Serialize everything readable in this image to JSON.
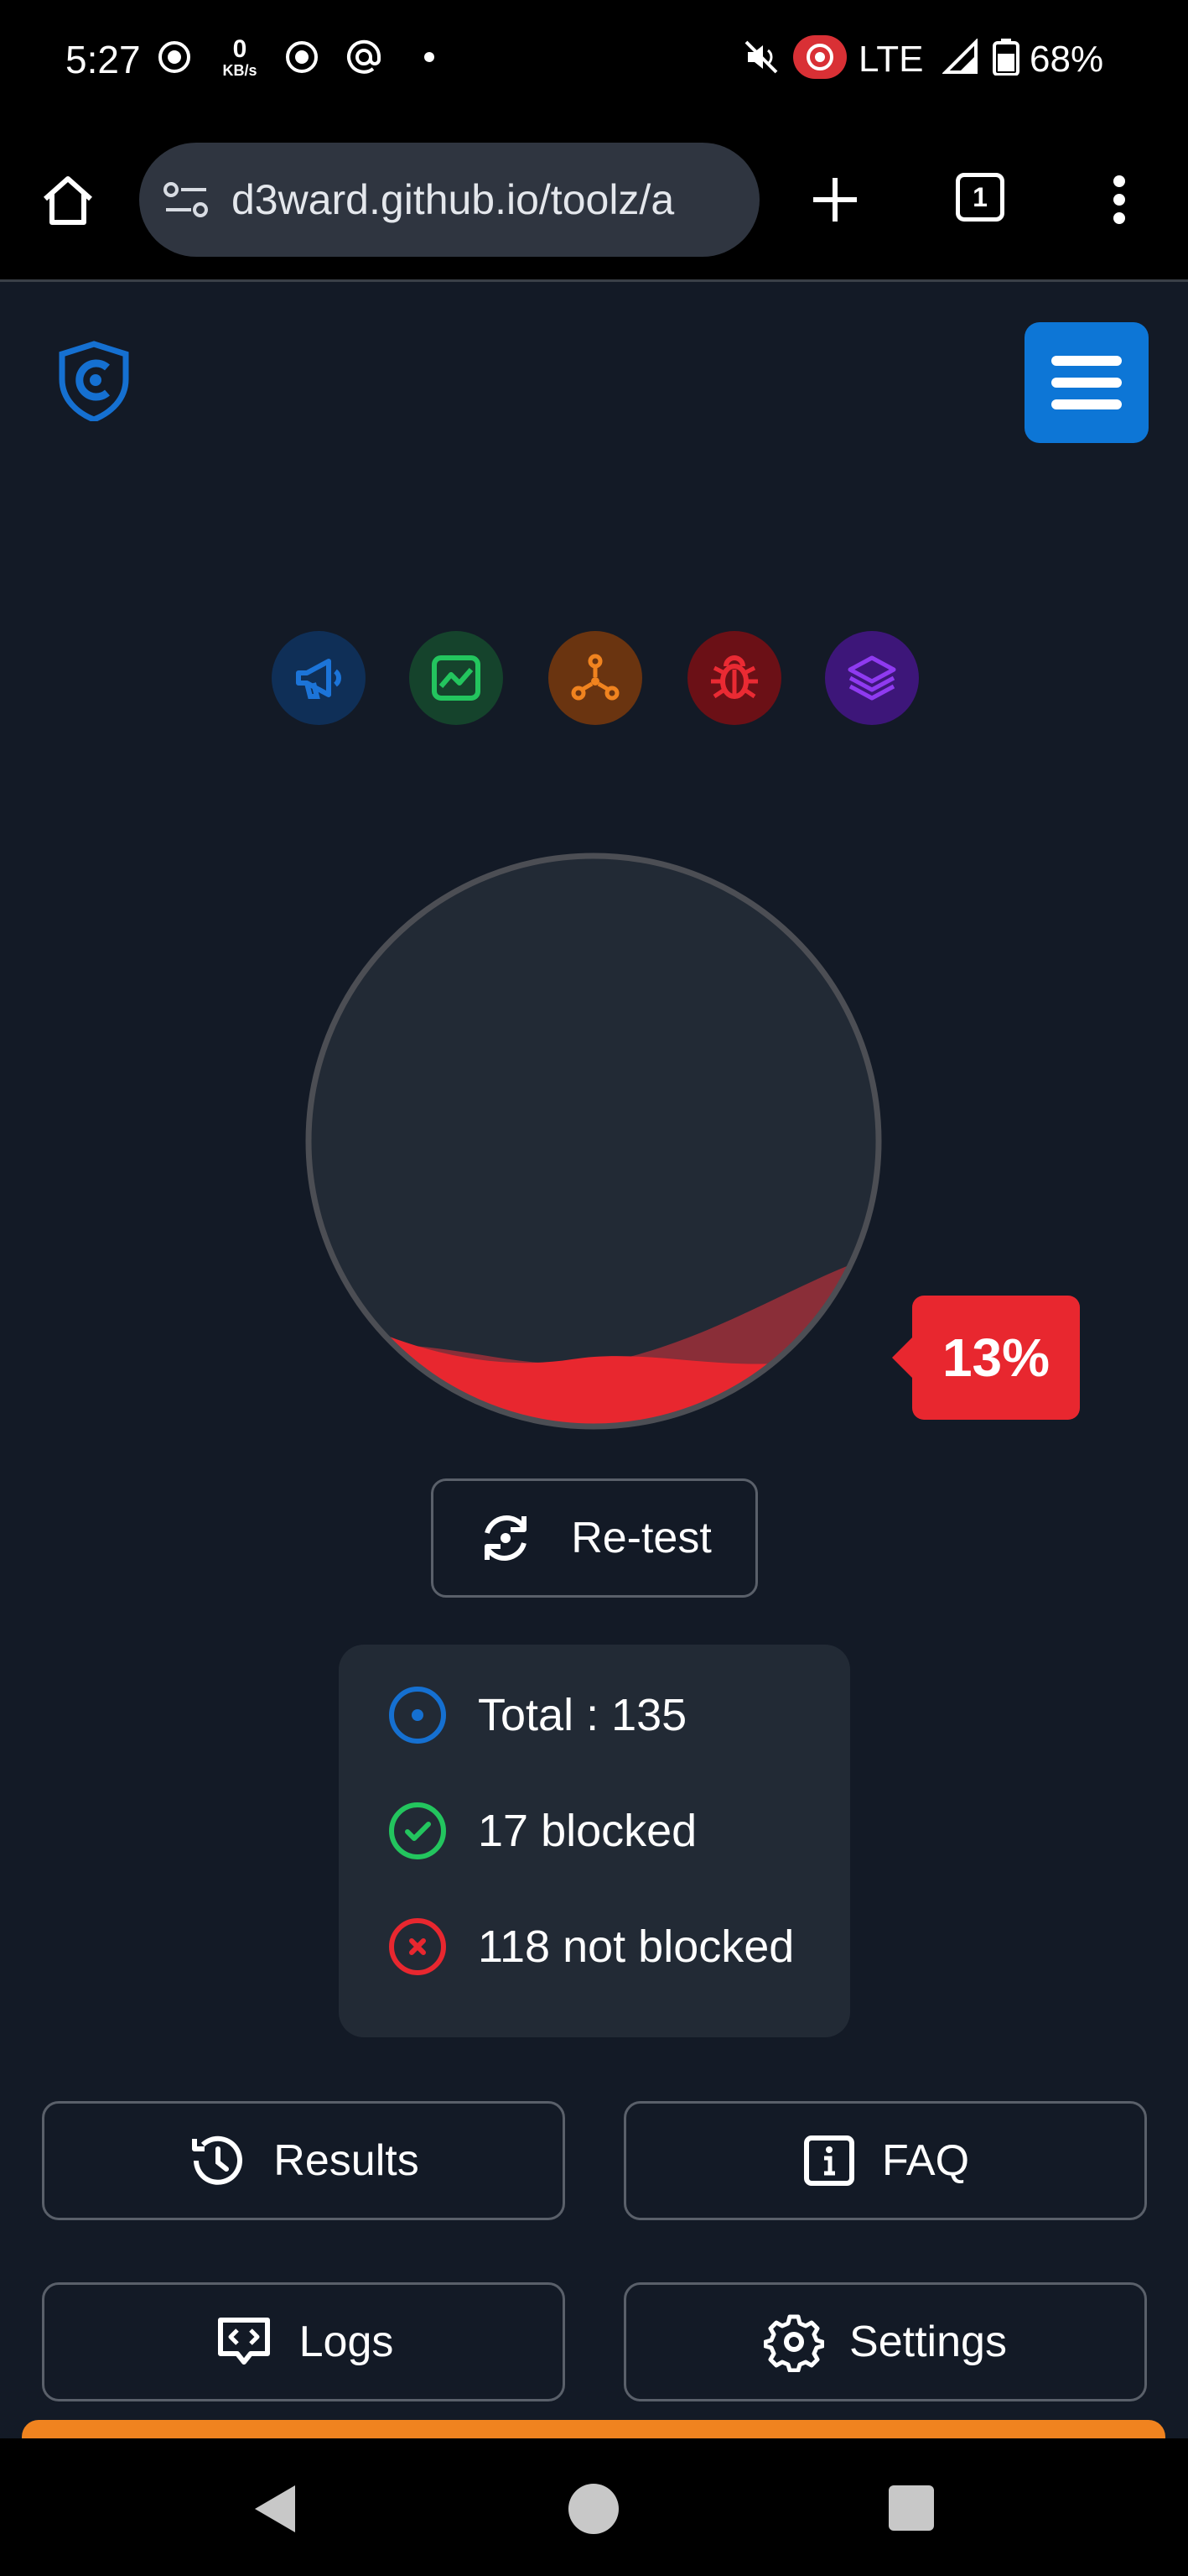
{
  "status_bar": {
    "time": "5:27",
    "net_speed": "0",
    "net_unit": "KB/s",
    "network": "LTE",
    "battery": "68%"
  },
  "browser": {
    "url": "d3ward.github.io/toolz/a",
    "tab_count": "1"
  },
  "categories": [
    {
      "name": "ads",
      "icon": "megaphone-icon",
      "bg": "#0f2f57",
      "fg": "#1c74d8"
    },
    {
      "name": "analytics",
      "icon": "chart-icon",
      "bg": "#15432c",
      "fg": "#23c55e"
    },
    {
      "name": "trackers",
      "icon": "network-icon",
      "bg": "#6a3410",
      "fg": "#f0831f"
    },
    {
      "name": "error-trackers",
      "icon": "bug-icon",
      "bg": "#6b1016",
      "fg": "#ea2a33"
    },
    {
      "name": "mix",
      "icon": "layers-icon",
      "bg": "#3d1679",
      "fg": "#8f3af0"
    }
  ],
  "gauge": {
    "percent_label": "13%",
    "fill_fraction": 0.13,
    "fill_color": "#e8272f"
  },
  "retest": {
    "label": "Re-test"
  },
  "stats": {
    "total": "Total : 135",
    "blocked": "17 blocked",
    "not_blocked": "118 not blocked"
  },
  "actions": {
    "results": "Results",
    "faq": "FAQ",
    "logs": "Logs",
    "settings": "Settings"
  },
  "colors": {
    "accent": "#0d76d6",
    "success": "#23c55e",
    "danger": "#e8272f",
    "background": "#131a26",
    "card": "#222a35"
  }
}
